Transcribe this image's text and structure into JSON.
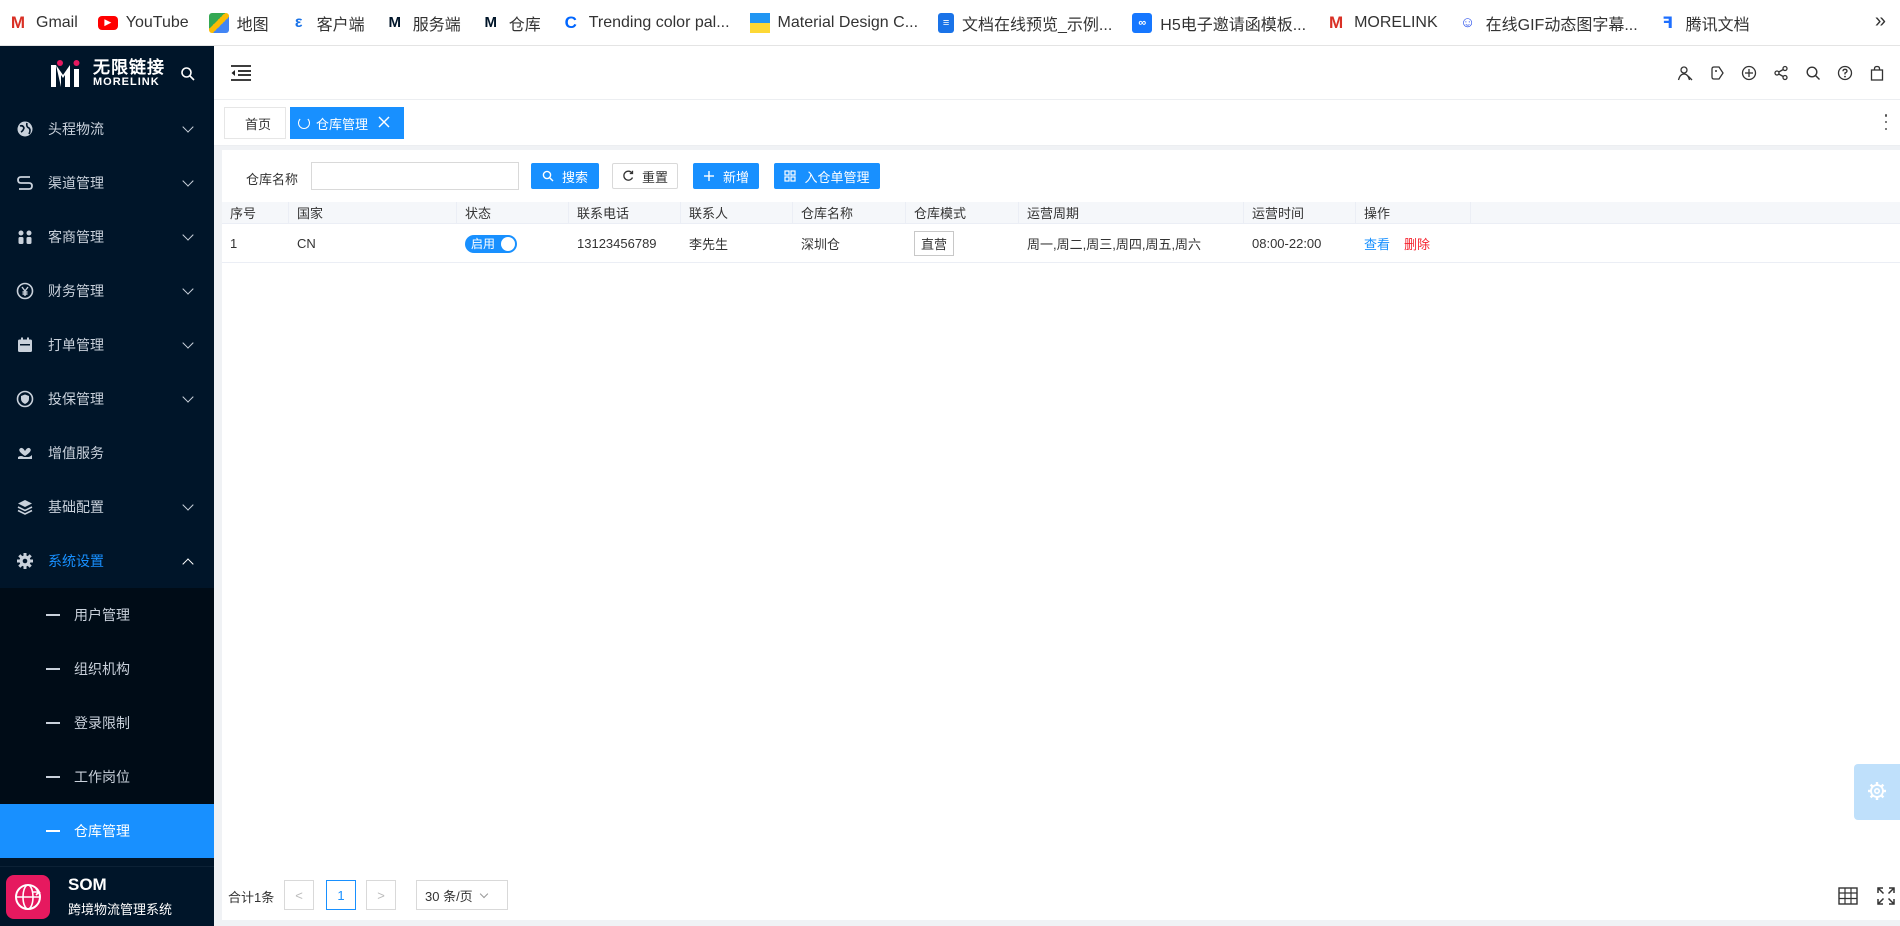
{
  "bookmarks": [
    {
      "label": "Gmail",
      "icon": "gmail-icon",
      "color": "#d93025"
    },
    {
      "label": "YouTube",
      "icon": "youtube-icon",
      "color": "#ff0000"
    },
    {
      "label": "地图",
      "icon": "maps-icon",
      "color": "#4285f4"
    },
    {
      "label": "客户端",
      "icon": "client-icon",
      "color": "#1a73e8"
    },
    {
      "label": "服务端",
      "icon": "morelink-icon",
      "color": "#001529"
    },
    {
      "label": "仓库",
      "icon": "morelink-icon",
      "color": "#001529"
    },
    {
      "label": "Trending color pal...",
      "icon": "coolors-icon",
      "color": "#0066ff"
    },
    {
      "label": "Material Design C...",
      "icon": "material-icon",
      "color": "#2196f3"
    },
    {
      "label": "文档在线预览_示例...",
      "icon": "doc-icon",
      "color": "#1a73e8"
    },
    {
      "label": "H5电子邀请函模板...",
      "icon": "h5-icon",
      "color": "#1677ff"
    },
    {
      "label": "MORELINK",
      "icon": "gmail-icon",
      "color": "#d93025"
    },
    {
      "label": "在线GIF动态图字幕...",
      "icon": "gif-icon",
      "color": "#2f54eb"
    },
    {
      "label": "腾讯文档",
      "icon": "tencent-doc-icon",
      "color": "#1e6fff"
    }
  ],
  "bookmarks_more": "»",
  "logo": {
    "cn": "无限链接",
    "en": "MORELINK"
  },
  "sidebar": {
    "items": [
      {
        "label": "头程物流",
        "icon": "globe-icon",
        "has_children": true
      },
      {
        "label": "渠道管理",
        "icon": "route-icon",
        "has_children": true
      },
      {
        "label": "客商管理",
        "icon": "users-icon",
        "has_children": true
      },
      {
        "label": "财务管理",
        "icon": "yuan-icon",
        "has_children": true
      },
      {
        "label": "打单管理",
        "icon": "calendar-icon",
        "has_children": true
      },
      {
        "label": "投保管理",
        "icon": "shield-icon",
        "has_children": true
      },
      {
        "label": "增值服务",
        "icon": "heart-hand-icon",
        "has_children": false
      },
      {
        "label": "基础配置",
        "icon": "layers-icon",
        "has_children": true
      },
      {
        "label": "系统设置",
        "icon": "gear-icon",
        "has_children": true,
        "open": true
      }
    ],
    "submenu": [
      {
        "label": "用户管理"
      },
      {
        "label": "组织机构"
      },
      {
        "label": "登录限制"
      },
      {
        "label": "工作岗位"
      },
      {
        "label": "仓库管理",
        "active": true
      }
    ]
  },
  "som": {
    "title": "SOM",
    "subtitle": "跨境物流管理系统"
  },
  "tabs": [
    {
      "label": "首页"
    },
    {
      "label": "仓库管理",
      "active": true
    }
  ],
  "filter": {
    "label": "仓库名称",
    "input_value": "",
    "buttons": {
      "search": "搜索",
      "reset": "重置",
      "add": "新增",
      "inbound": "入仓单管理"
    }
  },
  "table": {
    "columns": [
      "序号",
      "国家",
      "状态",
      "联系电话",
      "联系人",
      "仓库名称",
      "仓库模式",
      "运营周期",
      "运营时间",
      "操作"
    ],
    "rows": [
      {
        "index": "1",
        "country": "CN",
        "status": "启用",
        "status_on": true,
        "phone": "13123456789",
        "contact": "李先生",
        "warehouse_name": "深圳仓",
        "mode": "直营",
        "cycle": "周一,周二,周三,周四,周五,周六",
        "hours": "08:00-22:00",
        "actions": {
          "view": "查看",
          "delete": "删除"
        }
      }
    ]
  },
  "pagination": {
    "total_text": "合计1条",
    "prev": "<",
    "current_page": "1",
    "next": ">",
    "page_size": "30 条/页"
  },
  "colors": {
    "primary": "#1890ff",
    "sidebar_bg": "#001529",
    "danger": "#f5222d",
    "som_badge": "#e6195f"
  }
}
